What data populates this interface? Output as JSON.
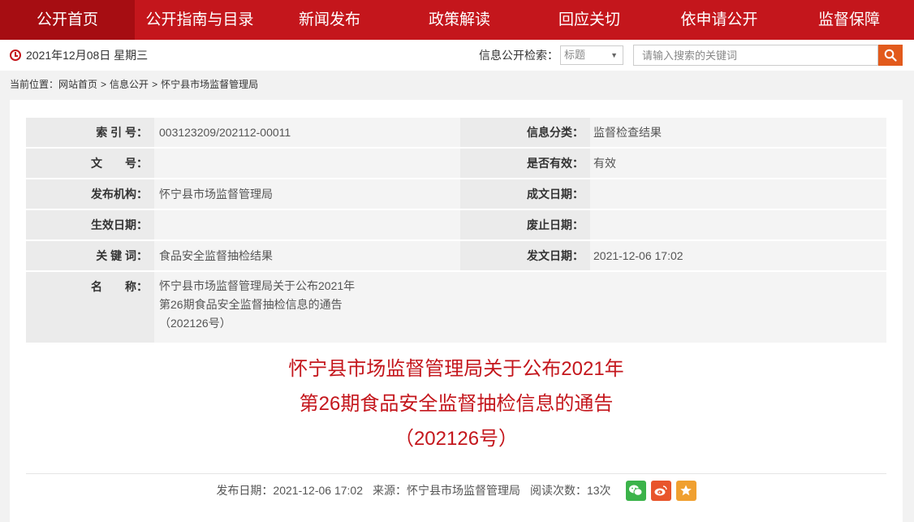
{
  "nav": {
    "items": [
      "公开首页",
      "公开指南与目录",
      "新闻发布",
      "政策解读",
      "回应关切",
      "依申请公开",
      "监督保障"
    ]
  },
  "topbar": {
    "date": "2021年12月08日 星期三",
    "search_label": "信息公开检索：",
    "select_value": "标题",
    "search_placeholder": "请输入搜索的关键词"
  },
  "breadcrumb": {
    "prefix": "当前位置：",
    "items": [
      "网站首页",
      "信息公开",
      "怀宁县市场监督管理局"
    ],
    "sep": ">"
  },
  "meta": {
    "index_label": "索 引 号：",
    "index_value": "003123209/202112-00011",
    "category_label": "信息分类：",
    "category_value": "监督检查结果",
    "docno_label": "文　　号：",
    "docno_value": "",
    "valid_label": "是否有效：",
    "valid_value": "有效",
    "publisher_label": "发布机构：",
    "publisher_value": "怀宁县市场监督管理局",
    "written_label": "成文日期：",
    "written_value": "",
    "effective_label": "生效日期：",
    "effective_value": "",
    "abolish_label": "废止日期：",
    "abolish_value": "",
    "keywords_label": "关 键 词：",
    "keywords_value": "食品安全监督抽检结果",
    "issued_label": "发文日期：",
    "issued_value": "2021-12-06 17:02",
    "name_label": "名　　称：",
    "name_lines": [
      "怀宁县市场监督管理局关于公布2021年",
      "第26期食品安全监督抽检信息的通告",
      "（202126号）"
    ]
  },
  "article": {
    "title_lines": [
      "怀宁县市场监督管理局关于公布2021年",
      "第26期食品安全监督抽检信息的通告",
      "（202126号）"
    ],
    "publish_date": "发布日期：2021-12-06 17:02",
    "source": "来源：怀宁县市场监督管理局",
    "views": "阅读次数：13次"
  },
  "colors": {
    "brand_red": "#c4161c",
    "wechat": "#3bb34a",
    "weibo": "#e8552c",
    "favorite": "#f0a030"
  }
}
